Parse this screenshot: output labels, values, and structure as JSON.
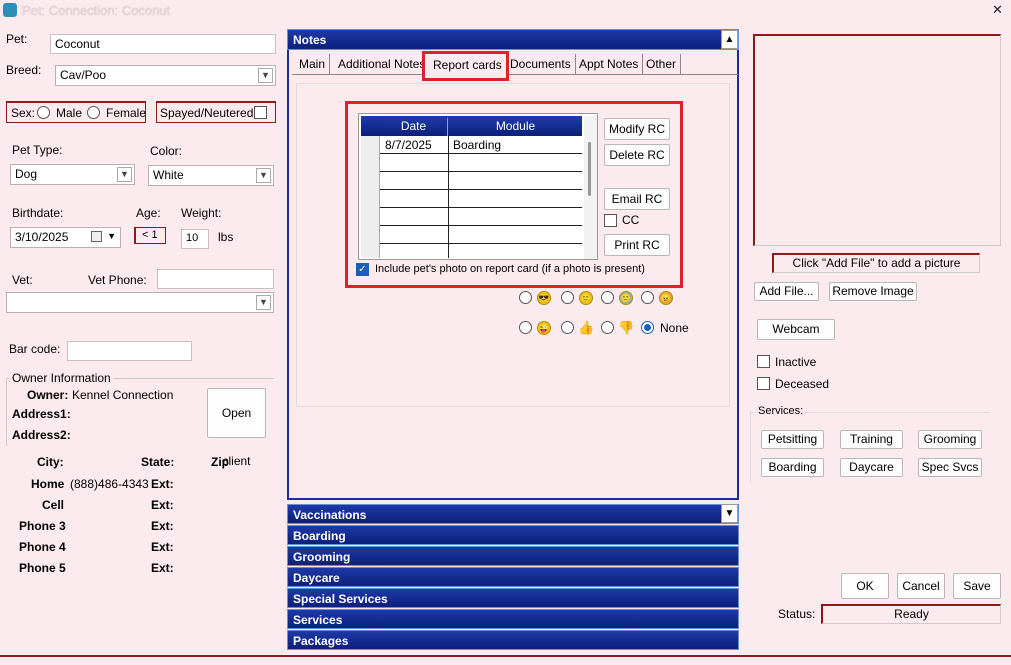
{
  "window": {
    "title": "Pet: Connection: Coconut",
    "close": "✕"
  },
  "pet": {
    "pet_label": "Pet:",
    "pet_value": "Coconut",
    "breed_label": "Breed:",
    "breed_value": "Cav/Poo",
    "sex_label": "Sex:",
    "male_label": "Male",
    "female_label": "Female",
    "spayed_label": "Spayed/Neutered:",
    "pet_type_label": "Pet Type:",
    "pet_type_value": "Dog",
    "color_label": "Color:",
    "color_value": "White",
    "birthdate_label": "Birthdate:",
    "birthdate_value": "3/10/2025",
    "age_label": "Age:",
    "age_value": "< 1",
    "weight_label": "Weight:",
    "weight_value": "10",
    "weight_unit": "lbs",
    "vet_label": "Vet:",
    "vet_phone_label": "Vet Phone:",
    "vet_phone_value": "",
    "vet_value": "",
    "barcode_label": "Bar code:",
    "barcode_value": ""
  },
  "owner": {
    "section_label": "Owner Information",
    "owner_label": "Owner:",
    "owner_value": "Kennel Connection",
    "address1_label": "Address1:",
    "address2_label": "Address2:",
    "open_client": "Open client",
    "city_label": "City:",
    "state_label": "State:",
    "zip_label": "Zip",
    "home_label": "Home",
    "home_value": "(888)486-4343",
    "cell_label": "Cell",
    "phone3_label": "Phone 3",
    "phone4_label": "Phone 4",
    "phone5_label": "Phone 5",
    "ext_label": "Ext:"
  },
  "notes": {
    "header": "Notes",
    "tabs": [
      "Main",
      "Additional Notes",
      "Report cards",
      "Documents",
      "Appt Notes",
      "Other"
    ],
    "active_tab": "Report cards",
    "grid": {
      "columns": [
        "Date",
        "Module"
      ],
      "rows": [
        {
          "date": "8/7/2025",
          "module": "Boarding"
        }
      ]
    },
    "buttons": {
      "modify": "Modify RC",
      "delete": "Delete RC",
      "email": "Email RC",
      "cc": "CC",
      "print": "Print RC"
    },
    "include_photo": "Include pet's photo on report card (if a photo is present)",
    "rating_none": "None"
  },
  "sections": [
    "Vaccinations",
    "Boarding",
    "Grooming",
    "Daycare",
    "Special Services",
    "Services",
    "Packages"
  ],
  "photo": {
    "hint": "Click \"Add File\" to add a picture",
    "add_file": "Add File...",
    "remove_image": "Remove Image",
    "webcam": "Webcam",
    "inactive": "Inactive",
    "deceased": "Deceased"
  },
  "services": {
    "label": "Services:",
    "buttons": [
      "Petsitting",
      "Training",
      "Grooming",
      "Boarding",
      "Daycare",
      "Spec Svcs"
    ]
  },
  "footer": {
    "ok": "OK",
    "cancel": "Cancel",
    "save": "Save",
    "status_label": "Status:",
    "status_value": "Ready"
  },
  "colors": {
    "accent": "#1a2e95",
    "highlight": "#e0202a",
    "background": "#fcebee"
  }
}
